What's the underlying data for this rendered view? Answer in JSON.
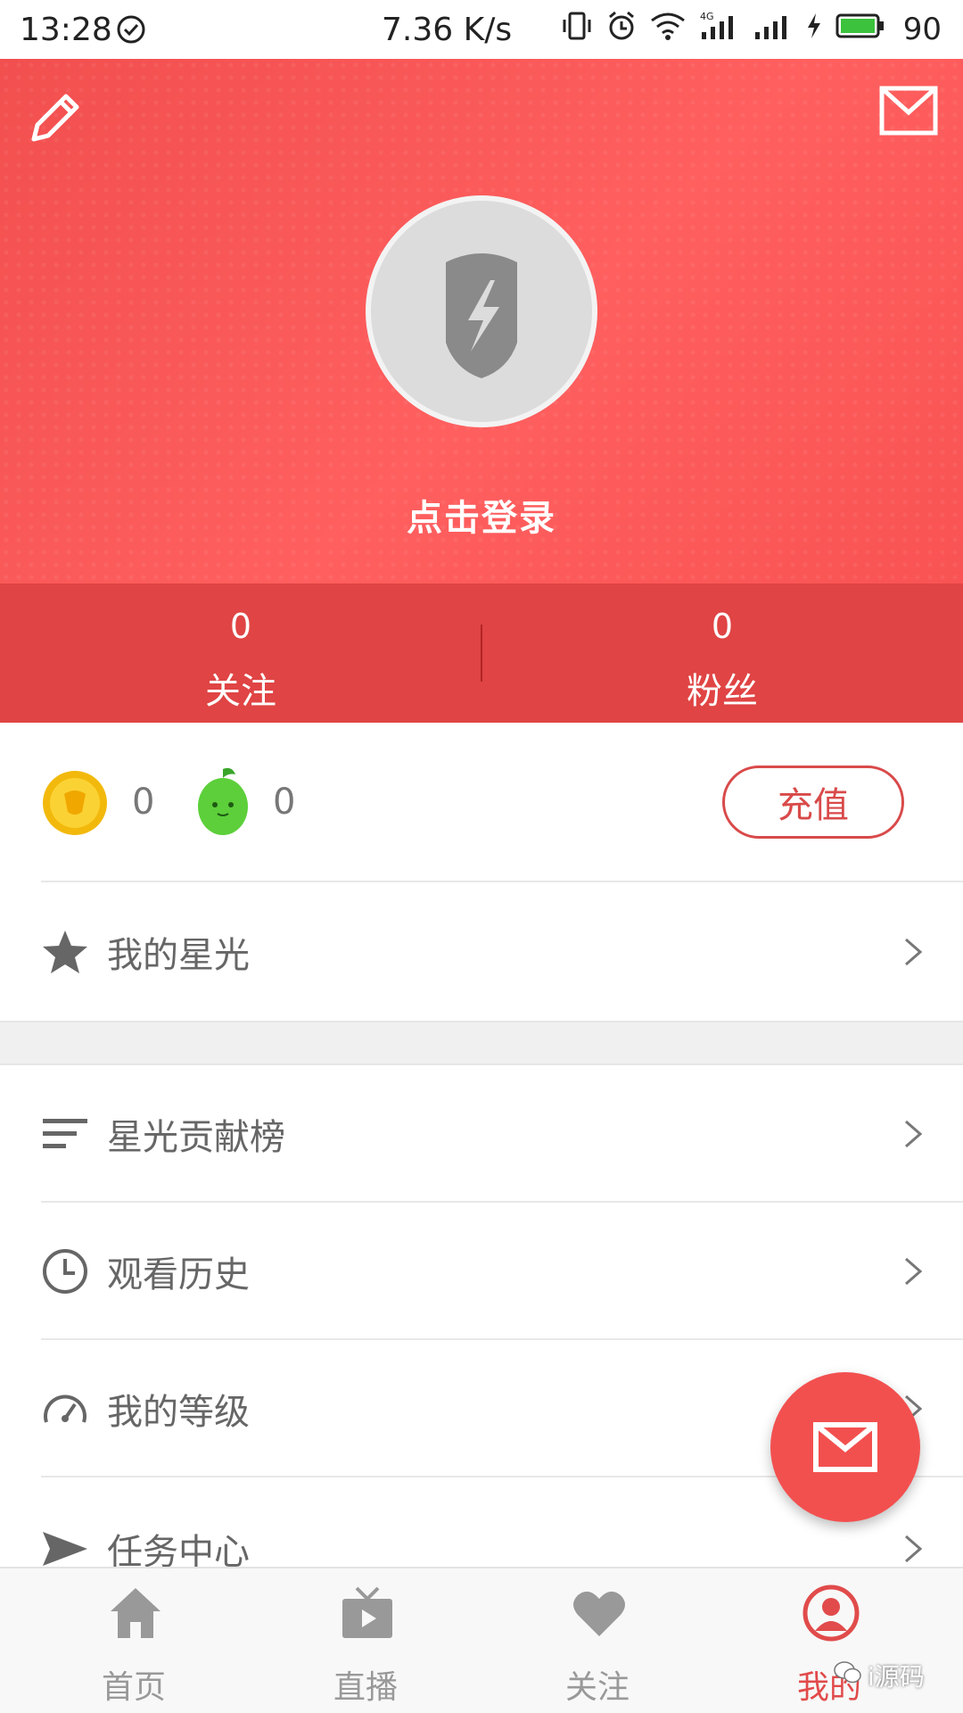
{
  "status_bar": {
    "time": "13:28",
    "net_speed": "7.36 K/s",
    "network": "4G",
    "battery": "90"
  },
  "profile": {
    "login_prompt": "点击登录",
    "following_count": "0",
    "following_label": "关注",
    "fans_count": "0",
    "fans_label": "粉丝"
  },
  "wallet": {
    "coins": "0",
    "beans": "0",
    "recharge_label": "充值"
  },
  "menu": {
    "items": [
      {
        "label": "我的星光",
        "icon": "star-icon"
      },
      {
        "label": "星光贡献榜",
        "icon": "ranking-icon"
      },
      {
        "label": "观看历史",
        "icon": "clock-icon"
      },
      {
        "label": "我的等级",
        "icon": "speedometer-icon"
      },
      {
        "label": "任务中心",
        "icon": "paper-plane-icon"
      }
    ]
  },
  "bottom_nav": {
    "items": [
      {
        "label": "首页",
        "icon": "home-icon"
      },
      {
        "label": "直播",
        "icon": "tv-icon"
      },
      {
        "label": "关注",
        "icon": "heart-icon"
      },
      {
        "label": "我的",
        "icon": "user-icon",
        "active": true
      }
    ]
  },
  "watermark": "i源码",
  "colors": {
    "accent": "#f2504f",
    "header_dark": "#e04444",
    "text_muted": "#666666"
  }
}
